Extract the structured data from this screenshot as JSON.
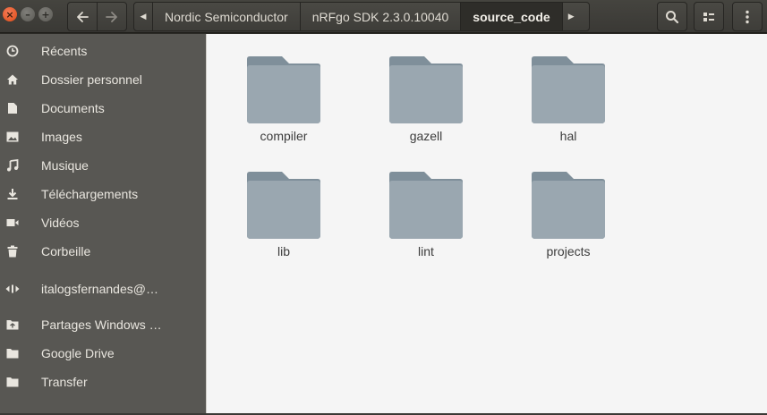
{
  "window": {
    "close_glyph": "×",
    "minimize_glyph": "–",
    "maximize_glyph": "+"
  },
  "toolbar": {
    "back_icon": "arrow-left-icon",
    "forward_icon": "arrow-right-icon",
    "search_icon": "search-icon",
    "view_icon": "list-view-icon",
    "menu_icon": "kebab-menu-icon"
  },
  "path": {
    "left_arrow": "◀",
    "right_arrow": "▶",
    "crumbs": [
      "Nordic Semiconductor",
      "nRFgo SDK 2.3.0.10040",
      "source_code"
    ]
  },
  "sidebar": {
    "items": [
      {
        "label": "Récents",
        "icon": "clock-icon"
      },
      {
        "label": "Dossier personnel",
        "icon": "home-icon"
      },
      {
        "label": "Documents",
        "icon": "document-icon"
      },
      {
        "label": "Images",
        "icon": "image-icon"
      },
      {
        "label": "Musique",
        "icon": "music-icon"
      },
      {
        "label": "Téléchargements",
        "icon": "download-icon"
      },
      {
        "label": "Vidéos",
        "icon": "video-icon"
      },
      {
        "label": "Corbeille",
        "icon": "trash-icon"
      },
      {
        "label": "italogsfernandes@…",
        "icon": "network-share-icon"
      },
      {
        "label": "Partages Windows …",
        "icon": "folder-share-icon"
      },
      {
        "label": "Google Drive",
        "icon": "folder-icon"
      },
      {
        "label": "Transfer",
        "icon": "folder-icon"
      }
    ]
  },
  "files": [
    {
      "name": "compiler"
    },
    {
      "name": "gazell"
    },
    {
      "name": "hal"
    },
    {
      "name": "lib"
    },
    {
      "name": "lint"
    },
    {
      "name": "projects"
    }
  ],
  "colors": {
    "folder_body": "#9aa7b0",
    "folder_tab": "#7f8f9a",
    "sidebar_bg": "#585753",
    "close_button": "#e9541f"
  }
}
